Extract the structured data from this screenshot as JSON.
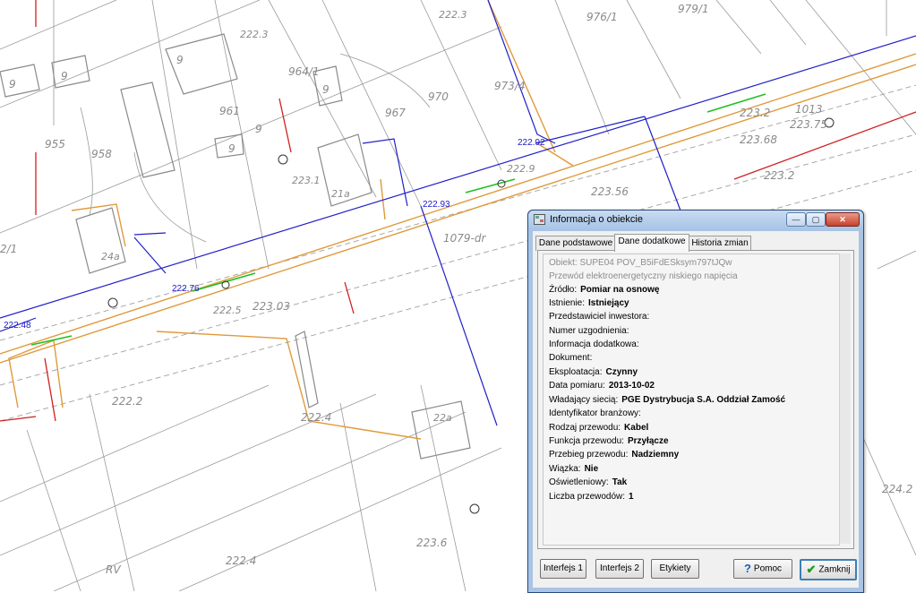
{
  "map": {
    "parcels": [
      "976/1",
      "979/1",
      "964/1",
      "961",
      "970",
      "967",
      "958",
      "955",
      "973/4",
      "1013",
      "1079-dr",
      "2/1",
      "24a",
      "21a",
      "22a",
      "RV",
      "9",
      "9",
      "9",
      "9",
      "9",
      "9"
    ],
    "heights": [
      "222.3",
      "222.3",
      "223.1",
      "222.9",
      "223.56",
      "223.2",
      "223.2",
      "223.75",
      "223.68",
      "222.5",
      "223.03",
      "222.2",
      "222.4",
      "223.6",
      "222.4",
      "224.2"
    ],
    "cable_labels": [
      "222.92",
      "222.93",
      "222.76",
      "222.48"
    ]
  },
  "window": {
    "title": "Informacja o obiekcie",
    "controls": {
      "minimize": "—",
      "maximize": "▢",
      "close": "✕"
    },
    "tabs": [
      "Dane podstawowe",
      "Dane dodatkowe",
      "Historia zmian"
    ],
    "active_tab": "Dane dodatkowe",
    "object_id": "Obiekt: SUPE04 POV_B5iFdESksym797tJQw",
    "object_type": "Przewód elektroenergetyczny niskiego napięcia",
    "fields": [
      {
        "label": "Źródło:",
        "value": "Pomiar na osnowę"
      },
      {
        "label": "Istnienie:",
        "value": "Istniejący"
      },
      {
        "label": "Przedstawiciel inwestora:",
        "value": ""
      },
      {
        "label": "Numer uzgodnienia:",
        "value": ""
      },
      {
        "label": "Informacja dodatkowa:",
        "value": ""
      },
      {
        "label": "Dokument:",
        "value": ""
      },
      {
        "label": "Eksploatacja:",
        "value": "Czynny"
      },
      {
        "label": "Data pomiaru:",
        "value": "2013-10-02"
      },
      {
        "label": "Władający siecią:",
        "value": "PGE Dystrybucja S.A. Oddział Zamość"
      },
      {
        "label": "Identyfikator branżowy:",
        "value": ""
      },
      {
        "label": "Rodzaj przewodu:",
        "value": "Kabel"
      },
      {
        "label": "Funkcja przewodu:",
        "value": "Przyłącze"
      },
      {
        "label": "Przebieg przewodu:",
        "value": "Nadziemny"
      },
      {
        "label": "Wiązka:",
        "value": "Nie"
      },
      {
        "label": "Oświetleniowy:",
        "value": "Tak"
      },
      {
        "label": "Liczba przewodów:",
        "value": "1"
      }
    ],
    "buttons": {
      "interface1": "Interfejs 1",
      "interface2": "Interfejs 2",
      "labels": "Etykiety",
      "help": "Pomoc",
      "help_icon": "?",
      "close": "Zamknij",
      "close_icon": "✔"
    }
  }
}
